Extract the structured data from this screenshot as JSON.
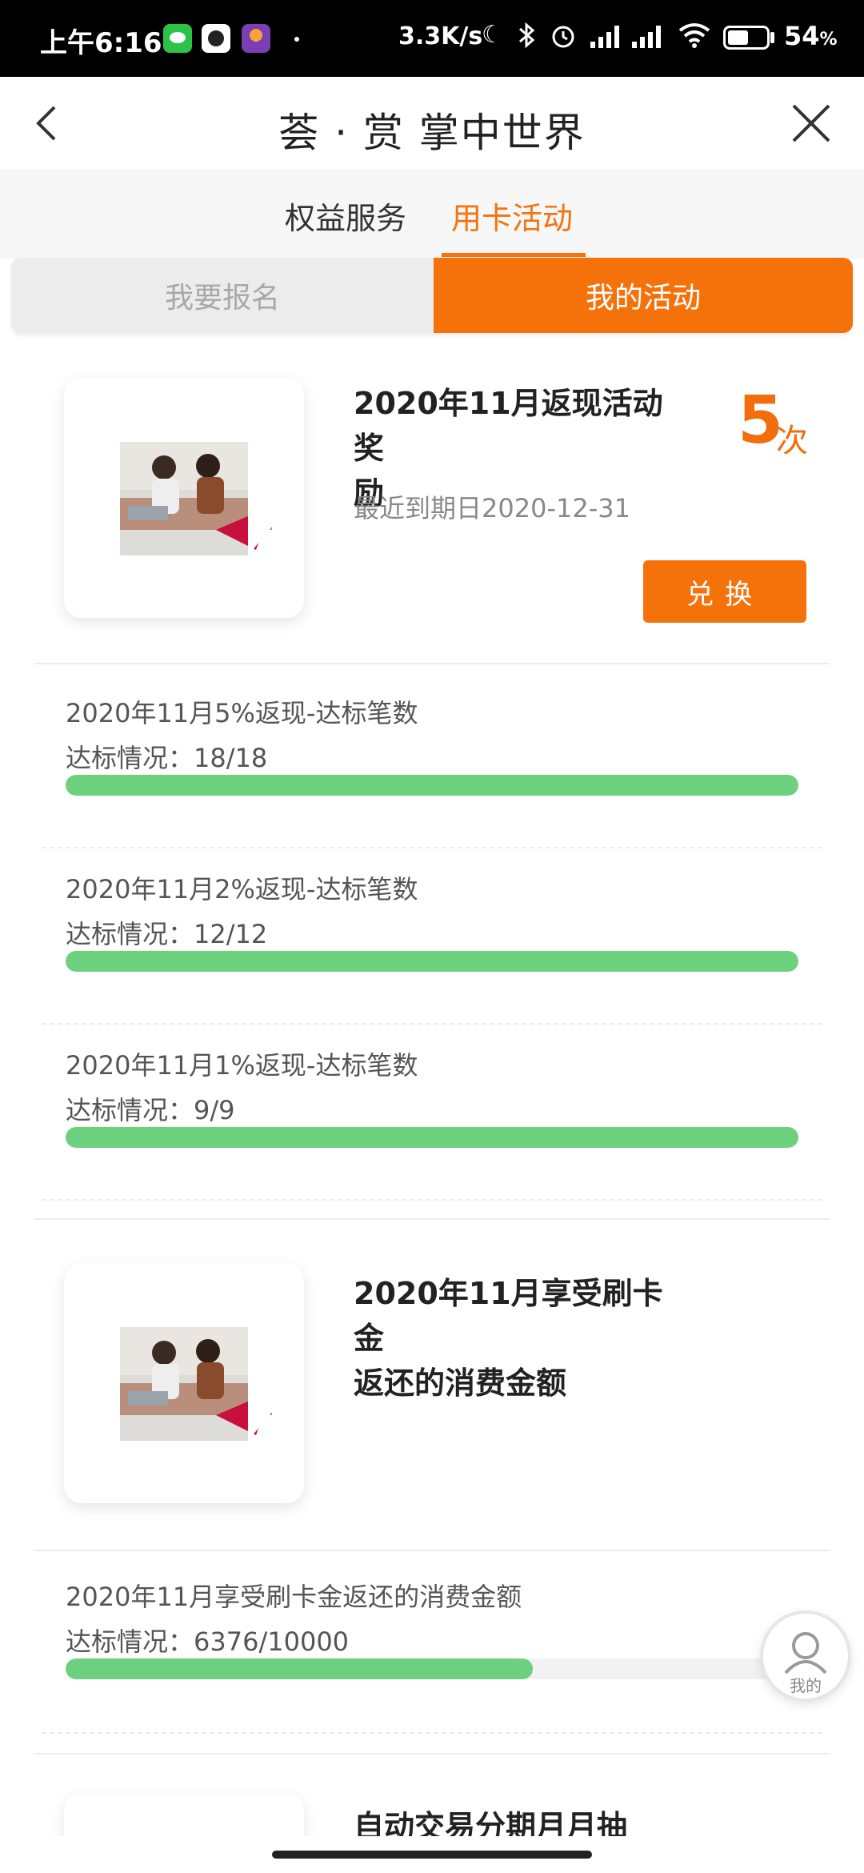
{
  "status_bar": {
    "time": "上午6:16",
    "net_speed": "3.3K/s",
    "battery_percent": "54",
    "battery_suffix": "%",
    "battery_level": 0.54
  },
  "header": {
    "title": "荟 · 赏 掌中世界",
    "back_icon": "chevron-left-icon",
    "close_icon": "close-icon"
  },
  "tabs": [
    {
      "label": "权益服务",
      "active": false
    },
    {
      "label": "用卡活动",
      "active": true
    }
  ],
  "segment": {
    "signup": "我要报名",
    "mine": "我的活动",
    "active": "mine"
  },
  "colors": {
    "accent": "#f5720b",
    "progress": "#6dd07e"
  },
  "activities": [
    {
      "title": "2020年11月返现活动奖励",
      "title_line1": "2020年11月返现活动奖",
      "title_line2": "励",
      "expiry": "最近到期日2020-12-31",
      "count": "5",
      "count_unit": "次",
      "button": "兑换",
      "tasks": [
        {
          "name": "2020年11月5%返现-达标笔数",
          "status_label": "达标情况：",
          "status": "18/18",
          "progress": 1.0
        },
        {
          "name": "2020年11月2%返现-达标笔数",
          "status_label": "达标情况：",
          "status": "12/12",
          "progress": 1.0
        },
        {
          "name": "2020年11月1%返现-达标笔数",
          "status_label": "达标情况：",
          "status": "9/9",
          "progress": 1.0
        }
      ]
    },
    {
      "title_line1": "2020年11月享受刷卡金",
      "title_line2": "返还的消费金额",
      "tasks": [
        {
          "name": "2020年11月享受刷卡金返还的消费金额",
          "status_label": "达标情况：",
          "status": "6376/10000",
          "progress": 0.6376
        }
      ]
    },
    {
      "title_line1": "自动交易分期月月抽"
    }
  ],
  "fab": {
    "label": "我的",
    "icon": "user-icon"
  }
}
